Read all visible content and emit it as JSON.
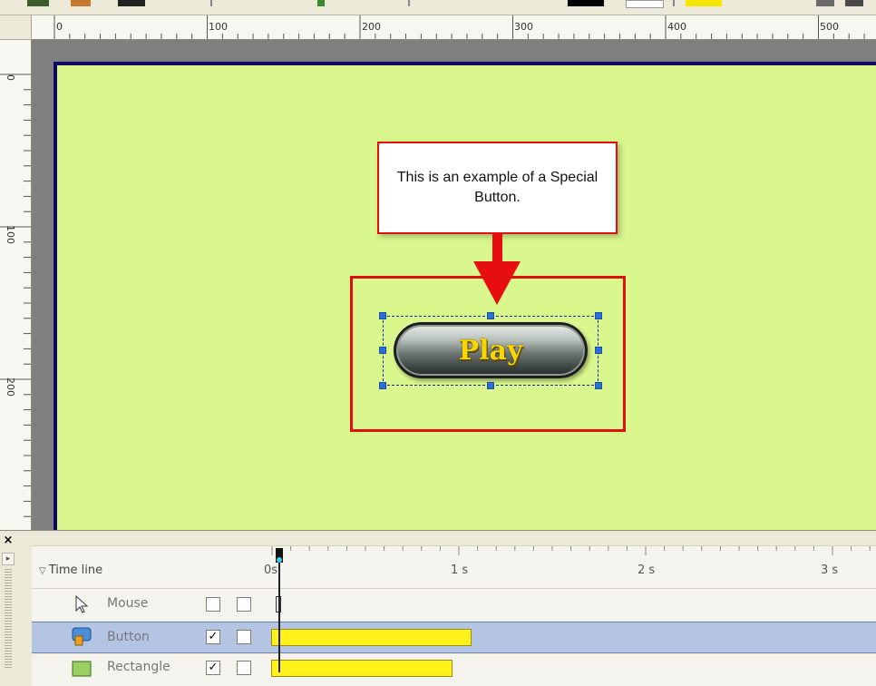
{
  "ruler": {
    "h_labels": [
      "0",
      "100",
      "200",
      "300",
      "400",
      "500"
    ],
    "v_labels": [
      "0",
      "100",
      "200"
    ]
  },
  "stage": {
    "background": "#d9f78d",
    "callout_text": "This is an example of a Special Button.",
    "button_label": "Play",
    "accent_red": "#e01010",
    "button_text_color": "#f6d500"
  },
  "timeline": {
    "title": "Time line",
    "time_labels": [
      "0s",
      "1 s",
      "2 s",
      "3 s"
    ],
    "tracks": [
      {
        "name": "Mouse",
        "icon": "mouse-cursor-icon",
        "visible": false,
        "locked": false
      },
      {
        "name": "Button",
        "icon": "button-object-icon",
        "visible": true,
        "locked": false,
        "selected": true
      },
      {
        "name": "Rectangle",
        "icon": "rectangle-object-icon",
        "visible": true,
        "locked": false
      }
    ],
    "bar_color": "#fff21a",
    "selected_row_color": "#b4c5e4"
  }
}
